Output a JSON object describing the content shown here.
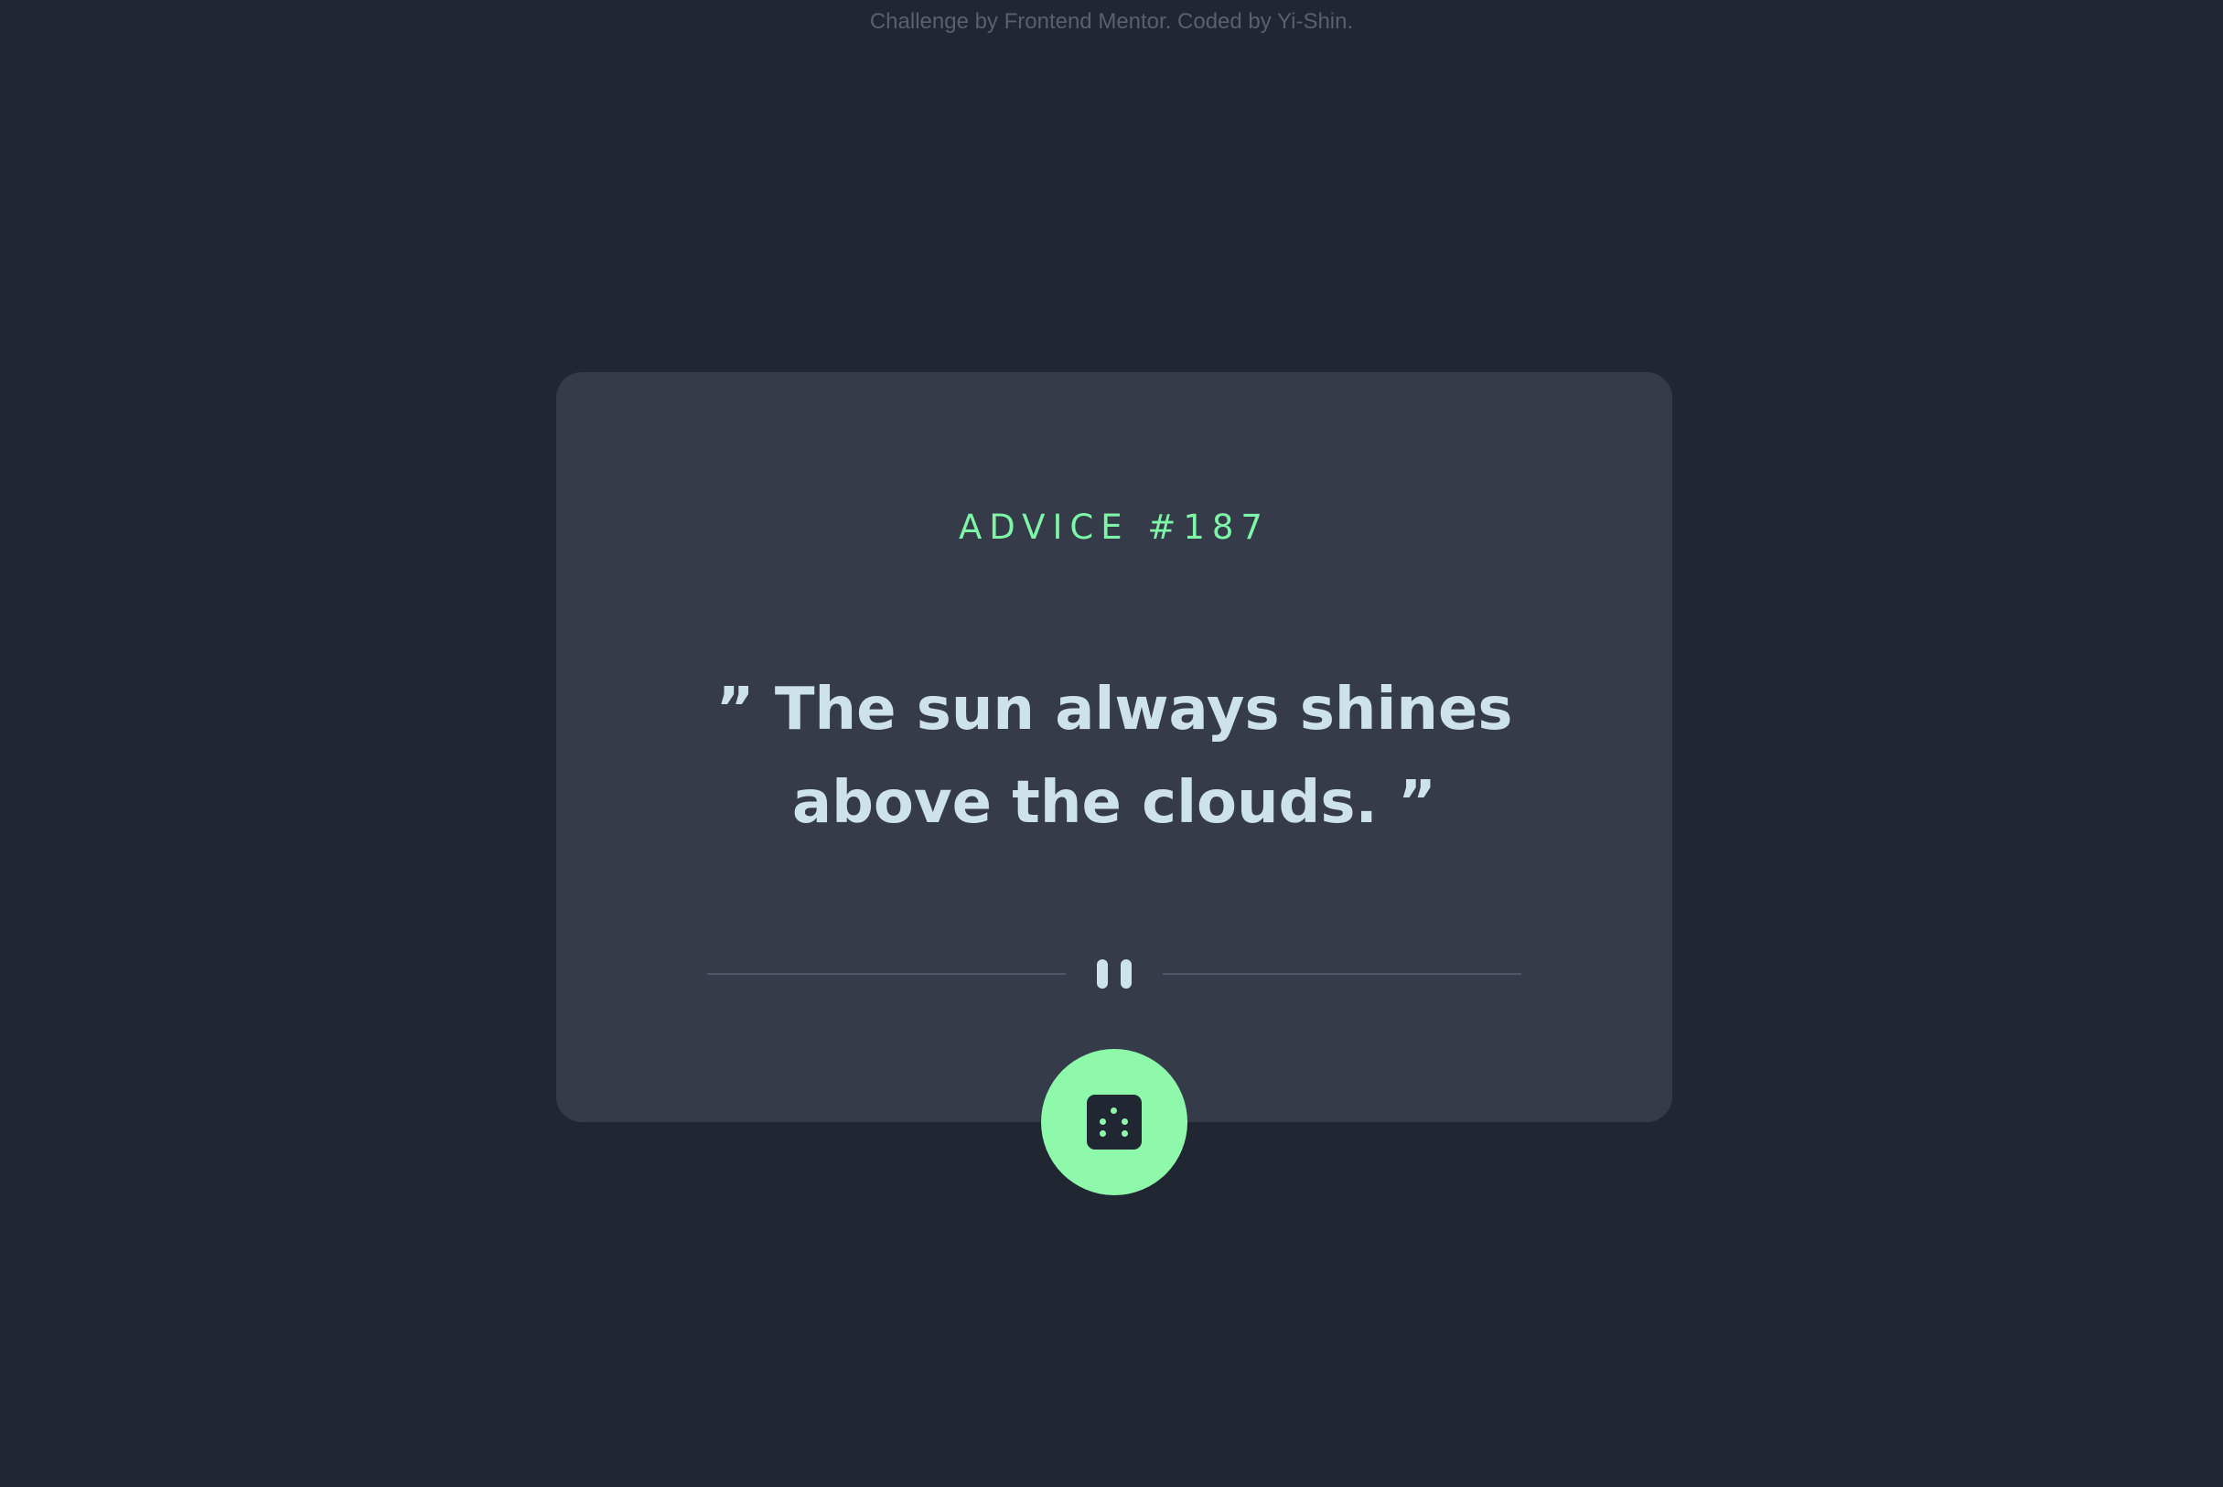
{
  "attribution": {
    "text": "Challenge by Frontend Mentor. Coded by Yi-Shin."
  },
  "card": {
    "advice_label": "ADVICE #187",
    "quote": "” The sun always shines above the clouds. ”",
    "divider_icon": "pause-icon"
  },
  "button": {
    "icon": "dice-icon",
    "accent_color": "#8ef9ab"
  },
  "colors": {
    "background": "#202632",
    "card": "#353b48",
    "accent": "#7ef6a8",
    "text": "#cee3e9"
  }
}
